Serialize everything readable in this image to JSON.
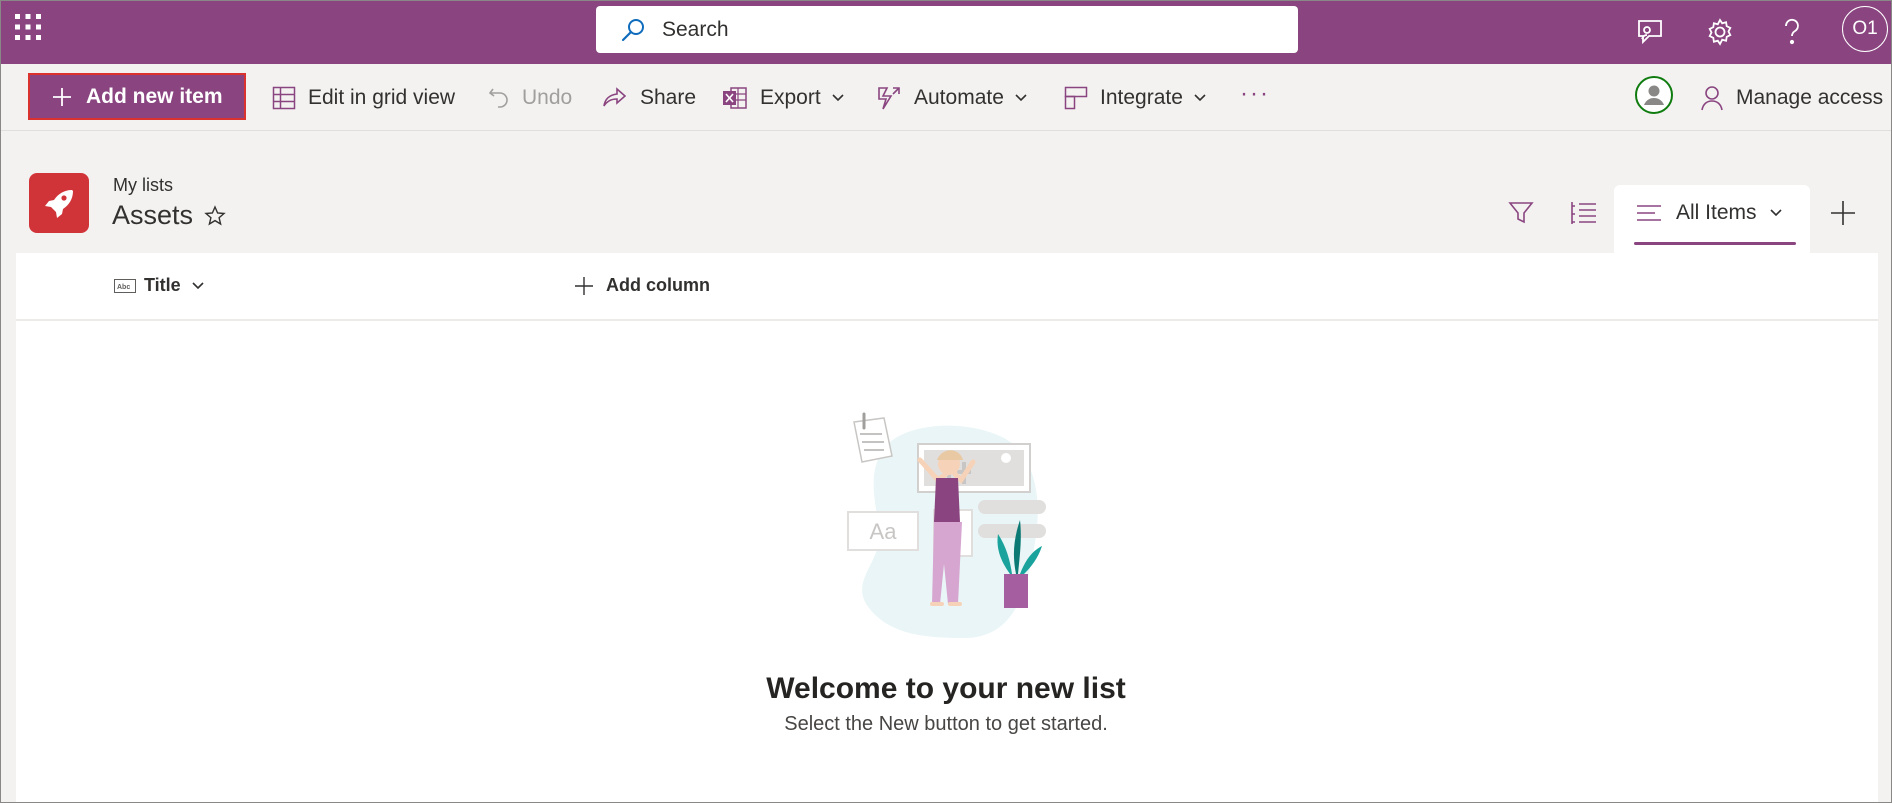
{
  "header": {
    "search_placeholder": "Search",
    "avatar_initials": "O1",
    "brand_color": "#8a4580"
  },
  "command_bar": {
    "new_item_label": "Add new item",
    "edit_grid_label": "Edit in grid view",
    "undo_label": "Undo",
    "share_label": "Share",
    "export_label": "Export",
    "automate_label": "Automate",
    "integrate_label": "Integrate",
    "more_label": "···",
    "manage_access_label": "Manage access"
  },
  "list": {
    "breadcrumb": "My lists",
    "title": "Assets",
    "view_name": "All Items",
    "icon_color": "#d13438"
  },
  "columns": {
    "title_label": "Title",
    "add_column_label": "Add column"
  },
  "empty_state": {
    "illustration_text": "Aa",
    "title": "Welcome to your new list",
    "subtitle": "Select the New button to get started."
  }
}
